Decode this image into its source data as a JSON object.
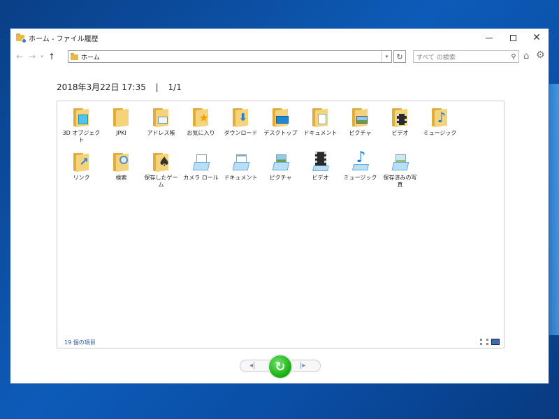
{
  "window": {
    "title": "ホーム - ファイル履歴"
  },
  "nav": {
    "address": "ホーム",
    "search_placeholder": "すべて の検索"
  },
  "timestamp": {
    "date": "2018年3月22日 17:35",
    "separator": "|",
    "page": "1/1"
  },
  "items": [
    {
      "label": "3D オブジェクト",
      "icon": "folder-3d-objects-icon"
    },
    {
      "label": "JPKI",
      "icon": "folder-icon"
    },
    {
      "label": "アドレス帳",
      "icon": "folder-contacts-icon"
    },
    {
      "label": "お気に入り",
      "icon": "folder-favorites-icon"
    },
    {
      "label": "ダウンロード",
      "icon": "folder-downloads-icon"
    },
    {
      "label": "デスクトップ",
      "icon": "folder-desktop-icon"
    },
    {
      "label": "ドキュメント",
      "icon": "folder-documents-icon"
    },
    {
      "label": "ピクチャ",
      "icon": "folder-pictures-icon"
    },
    {
      "label": "ビデオ",
      "icon": "folder-videos-icon"
    },
    {
      "label": "ミュージック",
      "icon": "folder-music-icon"
    },
    {
      "label": "リンク",
      "icon": "folder-links-icon"
    },
    {
      "label": "検索",
      "icon": "folder-searches-icon"
    },
    {
      "label": "保存したゲーム",
      "icon": "folder-saved-games-icon"
    },
    {
      "label": "カメラ ロール",
      "icon": "library-camera-roll-icon"
    },
    {
      "label": "ドキュメント",
      "icon": "library-documents-icon"
    },
    {
      "label": "ピクチャ",
      "icon": "library-pictures-icon"
    },
    {
      "label": "ビデオ",
      "icon": "library-videos-icon"
    },
    {
      "label": "ミュージック",
      "icon": "library-music-icon"
    },
    {
      "label": "保存済みの写真",
      "icon": "library-saved-pictures-icon"
    }
  ],
  "status": {
    "count": "19 個の項目"
  },
  "colors": {
    "accent": "#1fb51a",
    "folder": "#f5d37a",
    "link": "#2b5797"
  }
}
